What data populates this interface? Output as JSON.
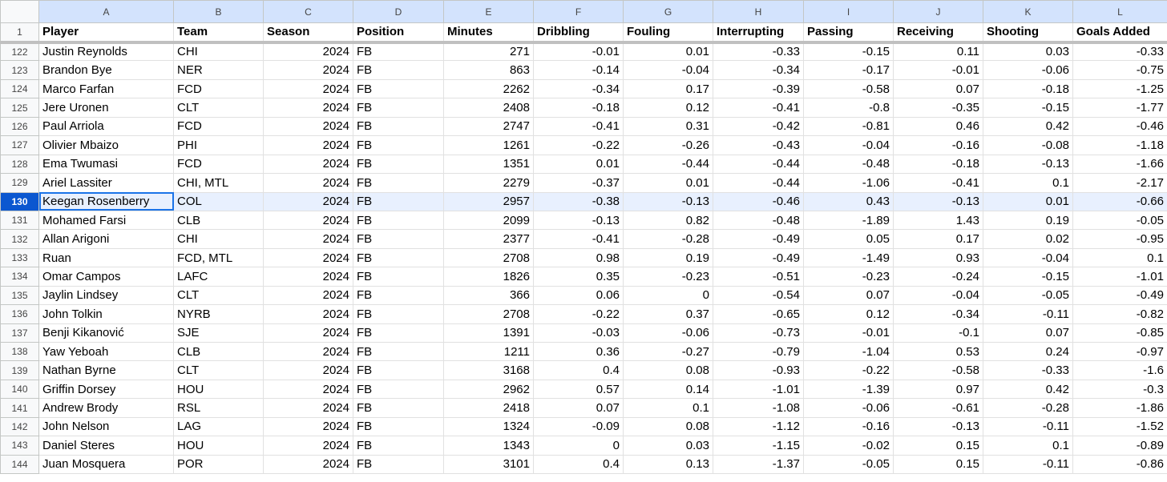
{
  "columns": [
    "A",
    "B",
    "C",
    "D",
    "E",
    "F",
    "G",
    "H",
    "I",
    "J",
    "K",
    "L"
  ],
  "headerRow": {
    "num": "1",
    "cells": [
      "Player",
      "Team",
      "Season",
      "Position",
      "Minutes",
      "Dribbling",
      "Fouling",
      "Interrupting",
      "Passing",
      "Receiving",
      "Shooting",
      "Goals Added"
    ]
  },
  "selected_row": "130",
  "rows": [
    {
      "num": "122",
      "cells": [
        "Justin Reynolds",
        "CHI",
        "2024",
        "FB",
        "271",
        "-0.01",
        "0.01",
        "-0.33",
        "-0.15",
        "0.11",
        "0.03",
        "-0.33"
      ]
    },
    {
      "num": "123",
      "cells": [
        "Brandon Bye",
        "NER",
        "2024",
        "FB",
        "863",
        "-0.14",
        "-0.04",
        "-0.34",
        "-0.17",
        "-0.01",
        "-0.06",
        "-0.75"
      ]
    },
    {
      "num": "124",
      "cells": [
        "Marco Farfan",
        "FCD",
        "2024",
        "FB",
        "2262",
        "-0.34",
        "0.17",
        "-0.39",
        "-0.58",
        "0.07",
        "-0.18",
        "-1.25"
      ]
    },
    {
      "num": "125",
      "cells": [
        "Jere Uronen",
        "CLT",
        "2024",
        "FB",
        "2408",
        "-0.18",
        "0.12",
        "-0.41",
        "-0.8",
        "-0.35",
        "-0.15",
        "-1.77"
      ]
    },
    {
      "num": "126",
      "cells": [
        "Paul Arriola",
        "FCD",
        "2024",
        "FB",
        "2747",
        "-0.41",
        "0.31",
        "-0.42",
        "-0.81",
        "0.46",
        "0.42",
        "-0.46"
      ]
    },
    {
      "num": "127",
      "cells": [
        "Olivier Mbaizo",
        "PHI",
        "2024",
        "FB",
        "1261",
        "-0.22",
        "-0.26",
        "-0.43",
        "-0.04",
        "-0.16",
        "-0.08",
        "-1.18"
      ]
    },
    {
      "num": "128",
      "cells": [
        "Ema Twumasi",
        "FCD",
        "2024",
        "FB",
        "1351",
        "0.01",
        "-0.44",
        "-0.44",
        "-0.48",
        "-0.18",
        "-0.13",
        "-1.66"
      ]
    },
    {
      "num": "129",
      "cells": [
        "Ariel Lassiter",
        "CHI, MTL",
        "2024",
        "FB",
        "2279",
        "-0.37",
        "0.01",
        "-0.44",
        "-1.06",
        "-0.41",
        "0.1",
        "-2.17"
      ]
    },
    {
      "num": "130",
      "cells": [
        "Keegan Rosenberry",
        "COL",
        "2024",
        "FB",
        "2957",
        "-0.38",
        "-0.13",
        "-0.46",
        "0.43",
        "-0.13",
        "0.01",
        "-0.66"
      ]
    },
    {
      "num": "131",
      "cells": [
        "Mohamed Farsi",
        "CLB",
        "2024",
        "FB",
        "2099",
        "-0.13",
        "0.82",
        "-0.48",
        "-1.89",
        "1.43",
        "0.19",
        "-0.05"
      ]
    },
    {
      "num": "132",
      "cells": [
        "Allan Arigoni",
        "CHI",
        "2024",
        "FB",
        "2377",
        "-0.41",
        "-0.28",
        "-0.49",
        "0.05",
        "0.17",
        "0.02",
        "-0.95"
      ]
    },
    {
      "num": "133",
      "cells": [
        "Ruan",
        "FCD, MTL",
        "2024",
        "FB",
        "2708",
        "0.98",
        "0.19",
        "-0.49",
        "-1.49",
        "0.93",
        "-0.04",
        "0.1"
      ]
    },
    {
      "num": "134",
      "cells": [
        "Omar Campos",
        "LAFC",
        "2024",
        "FB",
        "1826",
        "0.35",
        "-0.23",
        "-0.51",
        "-0.23",
        "-0.24",
        "-0.15",
        "-1.01"
      ]
    },
    {
      "num": "135",
      "cells": [
        "Jaylin Lindsey",
        "CLT",
        "2024",
        "FB",
        "366",
        "0.06",
        "0",
        "-0.54",
        "0.07",
        "-0.04",
        "-0.05",
        "-0.49"
      ]
    },
    {
      "num": "136",
      "cells": [
        "John Tolkin",
        "NYRB",
        "2024",
        "FB",
        "2708",
        "-0.22",
        "0.37",
        "-0.65",
        "0.12",
        "-0.34",
        "-0.11",
        "-0.82"
      ]
    },
    {
      "num": "137",
      "cells": [
        "Benji Kikanović",
        "SJE",
        "2024",
        "FB",
        "1391",
        "-0.03",
        "-0.06",
        "-0.73",
        "-0.01",
        "-0.1",
        "0.07",
        "-0.85"
      ]
    },
    {
      "num": "138",
      "cells": [
        "Yaw Yeboah",
        "CLB",
        "2024",
        "FB",
        "1211",
        "0.36",
        "-0.27",
        "-0.79",
        "-1.04",
        "0.53",
        "0.24",
        "-0.97"
      ]
    },
    {
      "num": "139",
      "cells": [
        "Nathan Byrne",
        "CLT",
        "2024",
        "FB",
        "3168",
        "0.4",
        "0.08",
        "-0.93",
        "-0.22",
        "-0.58",
        "-0.33",
        "-1.6"
      ]
    },
    {
      "num": "140",
      "cells": [
        "Griffin Dorsey",
        "HOU",
        "2024",
        "FB",
        "2962",
        "0.57",
        "0.14",
        "-1.01",
        "-1.39",
        "0.97",
        "0.42",
        "-0.3"
      ]
    },
    {
      "num": "141",
      "cells": [
        "Andrew Brody",
        "RSL",
        "2024",
        "FB",
        "2418",
        "0.07",
        "0.1",
        "-1.08",
        "-0.06",
        "-0.61",
        "-0.28",
        "-1.86"
      ]
    },
    {
      "num": "142",
      "cells": [
        "John Nelson",
        "LAG",
        "2024",
        "FB",
        "1324",
        "-0.09",
        "0.08",
        "-1.12",
        "-0.16",
        "-0.13",
        "-0.11",
        "-1.52"
      ]
    },
    {
      "num": "143",
      "cells": [
        "Daniel Steres",
        "HOU",
        "2024",
        "FB",
        "1343",
        "0",
        "0.03",
        "-1.15",
        "-0.02",
        "0.15",
        "0.1",
        "-0.89"
      ]
    },
    {
      "num": "144",
      "cells": [
        "Juan Mosquera",
        "POR",
        "2024",
        "FB",
        "3101",
        "0.4",
        "0.13",
        "-1.37",
        "-0.05",
        "0.15",
        "-0.11",
        "-0.86"
      ]
    }
  ],
  "colors": {
    "column_header_bg": "#d3e3fd",
    "selected_row_bg": "#e8f0fe",
    "selected_rownum_bg": "#0b57d0",
    "active_cell_border": "#1a73e8"
  }
}
